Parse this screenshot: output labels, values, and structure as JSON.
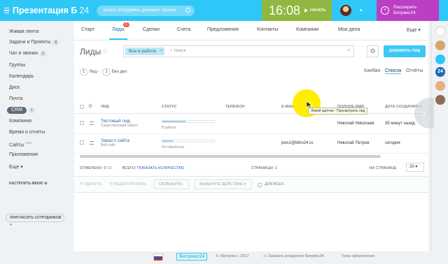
{
  "topbar": {
    "portal_title": "Презентация Б",
    "portal_number": "24",
    "search_placeholder": "искать сотрудника, документ, прочее...",
    "clock": "16:08",
    "start_label": "НАЧАТЬ",
    "upgrade_line1": "Расширить",
    "upgrade_line2": "Битрикс24",
    "colors": {
      "topbar": "#2fc7f7",
      "time_block": "#8fb741",
      "upgrade": "#bb3ec3"
    }
  },
  "sidebar": {
    "items": [
      {
        "label": "Живая лента",
        "badge": ""
      },
      {
        "label": "Задачи и Проекты",
        "badge": "8"
      },
      {
        "label": "Чат и звонки",
        "badge": "2"
      },
      {
        "label": "Группы",
        "badge": ""
      },
      {
        "label": "Календарь",
        "badge": ""
      },
      {
        "label": "Диск",
        "badge": ""
      },
      {
        "label": "Почта",
        "badge": ""
      },
      {
        "label": "CRM",
        "badge": "1"
      },
      {
        "label": "Компания",
        "badge": ""
      },
      {
        "label": "Время и отчеты",
        "badge": ""
      },
      {
        "label": "Сайты",
        "badge": "beta"
      },
      {
        "label": "Приложения",
        "badge": ""
      },
      {
        "label": "Еще",
        "badge": ""
      }
    ],
    "configure_menu": "НАСТРОИТЬ МЕНЮ",
    "invite": "ПРИГЛАСИТЬ СОТРУДНИКОВ"
  },
  "tabs": {
    "items": [
      "Старт",
      "Лиды",
      "Сделки",
      "Счета",
      "Предложения",
      "Контакты",
      "Компании",
      "Мои дела",
      "Еще"
    ],
    "active": "Лиды",
    "lead_badge": "1"
  },
  "page": {
    "title": "Лиды",
    "filter_pill": "Все в работе",
    "filter_placeholder": "+ поиск",
    "add_button": "ДОБАВИТЬ ЛИД",
    "stat_leads_count": "1",
    "stat_leads_label": "Лид -",
    "stat_nodeal_count": "1",
    "stat_nodeal_label": "Без дел",
    "views": [
      "Канбан",
      "Список",
      "Отчёты"
    ],
    "active_view": "Список"
  },
  "table": {
    "headers": [
      "ЛИД",
      "СТАТУС",
      "ТЕЛЕФОН",
      "E-MAIL",
      "ПОЛНОЕ ИМЯ",
      "ДАТА СОЗДАНИЯ"
    ],
    "rows": [
      {
        "lead": "Тестовый лид",
        "lead_sub": "Существующий клиент",
        "status": "В работе",
        "status_progress": 0.45,
        "phone": "",
        "email": "",
        "full_name": "Николай Николаев",
        "created": "35 минут назад"
      },
      {
        "lead": "Заказ с сайта",
        "lead_sub": "Веб-сайт",
        "status": "Не обработан",
        "status_progress": 0.2,
        "phone": "",
        "email": "pws1@bitro24.ru",
        "full_name": "Николай Петров",
        "created": "сегодня"
      }
    ],
    "tooltip": "Левой щелчок - Просмотреть лид"
  },
  "footer": {
    "selected": "ОТМЕЧЕНО: 0 / 2",
    "total_label": "ВСЕГО:",
    "show_count": "ПОКАЗАТЬ КОЛИЧЕСТВО",
    "pages": "СТРАНИЦЫ: 1",
    "per_page_label": "НА СТРАНИЦЕ:",
    "per_page_value": "20",
    "actions": [
      "УДАЛИТЬ",
      "РЕДАКТИРОВАТЬ",
      "ОБЗВОНИТЬ"
    ],
    "select_action": "ВЫБЕРИТЕ ДЕЙСТВИЕ",
    "for_all": "ДЛЯ ВСЕХ"
  },
  "bottom": {
    "logo": "Битрикс24",
    "copyright": "© «Битрикс», 2017",
    "order": "Заказать внедрение Битрикс24",
    "theme": "Тема оформления"
  }
}
